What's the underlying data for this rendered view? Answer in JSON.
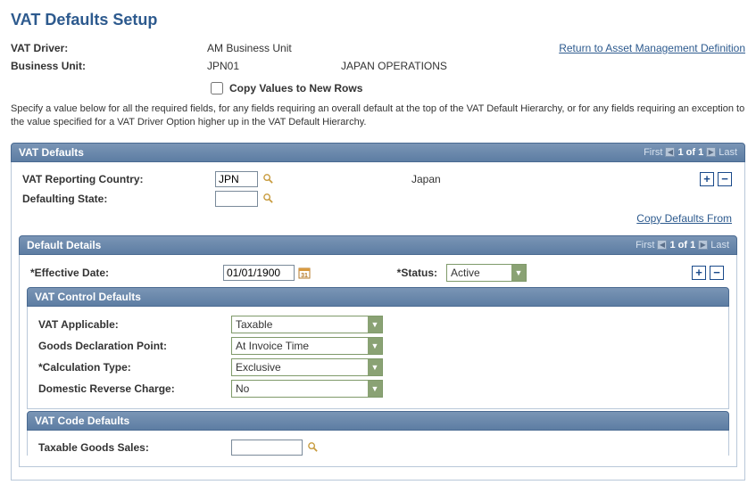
{
  "page": {
    "title": "VAT Defaults Setup"
  },
  "header": {
    "driver_label": "VAT Driver:",
    "driver_value": "AM Business Unit",
    "bu_label": "Business Unit:",
    "bu_value": "JPN01",
    "bu_desc": "JAPAN OPERATIONS",
    "return_link": "Return to Asset Management Definition",
    "copy_checkbox_label": "Copy Values to New Rows",
    "description": "Specify a value below for all the required fields, for any fields requiring an overall default at the top of the VAT Default Hierarchy, or for any fields requiring an exception to the value specified for a VAT Driver Option higher up in the VAT Default Hierarchy."
  },
  "nav": {
    "first": "First",
    "counter": "1 of 1",
    "last": "Last"
  },
  "vat_defaults": {
    "section_title": "VAT Defaults",
    "reporting_country_label": "VAT Reporting Country:",
    "reporting_country_value": "JPN",
    "reporting_country_name": "Japan",
    "defaulting_state_label": "Defaulting State:",
    "defaulting_state_value": "",
    "copy_defaults_link": "Copy Defaults From"
  },
  "default_details": {
    "section_title": "Default Details",
    "effective_date_label": "*Effective Date:",
    "effective_date_value": "01/01/1900",
    "status_label": "*Status:",
    "status_value": "Active"
  },
  "vat_control": {
    "section_title": "VAT Control Defaults",
    "applicable_label": "VAT Applicable:",
    "applicable_value": "Taxable",
    "goods_decl_label": "Goods Declaration Point:",
    "goods_decl_value": "At Invoice Time",
    "calc_type_label": "*Calculation Type:",
    "calc_type_value": "Exclusive",
    "domestic_rev_label": "Domestic Reverse Charge:",
    "domestic_rev_value": "No"
  },
  "vat_code": {
    "section_title": "VAT Code Defaults",
    "taxable_goods_label": "Taxable Goods Sales:",
    "taxable_goods_value": ""
  }
}
